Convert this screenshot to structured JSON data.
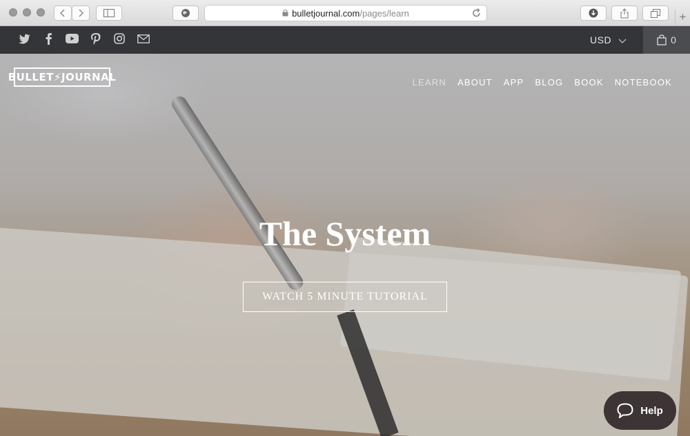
{
  "browser": {
    "url_domain": "bulletjournal.com",
    "url_path": "/pages/learn"
  },
  "topbar": {
    "social_icons": [
      "twitter-icon",
      "facebook-icon",
      "youtube-icon",
      "pinterest-icon",
      "instagram-icon",
      "mail-icon"
    ],
    "currency": "USD",
    "cart_count": "0"
  },
  "header": {
    "logo_text": "BULLET⚡JOURNAL",
    "nav": [
      "LEARN",
      "ABOUT",
      "APP",
      "BLOG",
      "BOOK",
      "NOTEBOOK"
    ]
  },
  "hero": {
    "title": "The System",
    "cta_label": "WATCH 5 MINUTE TUTORIAL"
  },
  "help": {
    "label": "Help"
  }
}
